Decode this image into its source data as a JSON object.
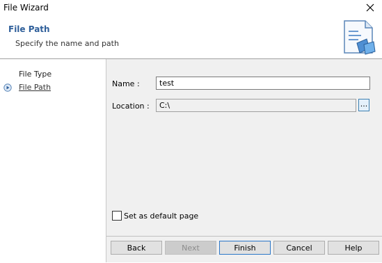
{
  "window": {
    "title": "File Wizard"
  },
  "header": {
    "title": "File Path",
    "subtitle": "Specify the name and path"
  },
  "steps": [
    {
      "label": "File Type"
    },
    {
      "label": "File Path"
    }
  ],
  "form": {
    "name_label": "Name :",
    "name_value": "test",
    "location_label": "Location :",
    "location_value": "C:\\",
    "browse_label": "...",
    "default_page_label": "Set as default page"
  },
  "buttons": {
    "back": "Back",
    "next": "Next",
    "finish": "Finish",
    "cancel": "Cancel",
    "help": "Help"
  },
  "colors": {
    "accent": "#2f5f9a",
    "content_bg": "#f0f0f0"
  }
}
